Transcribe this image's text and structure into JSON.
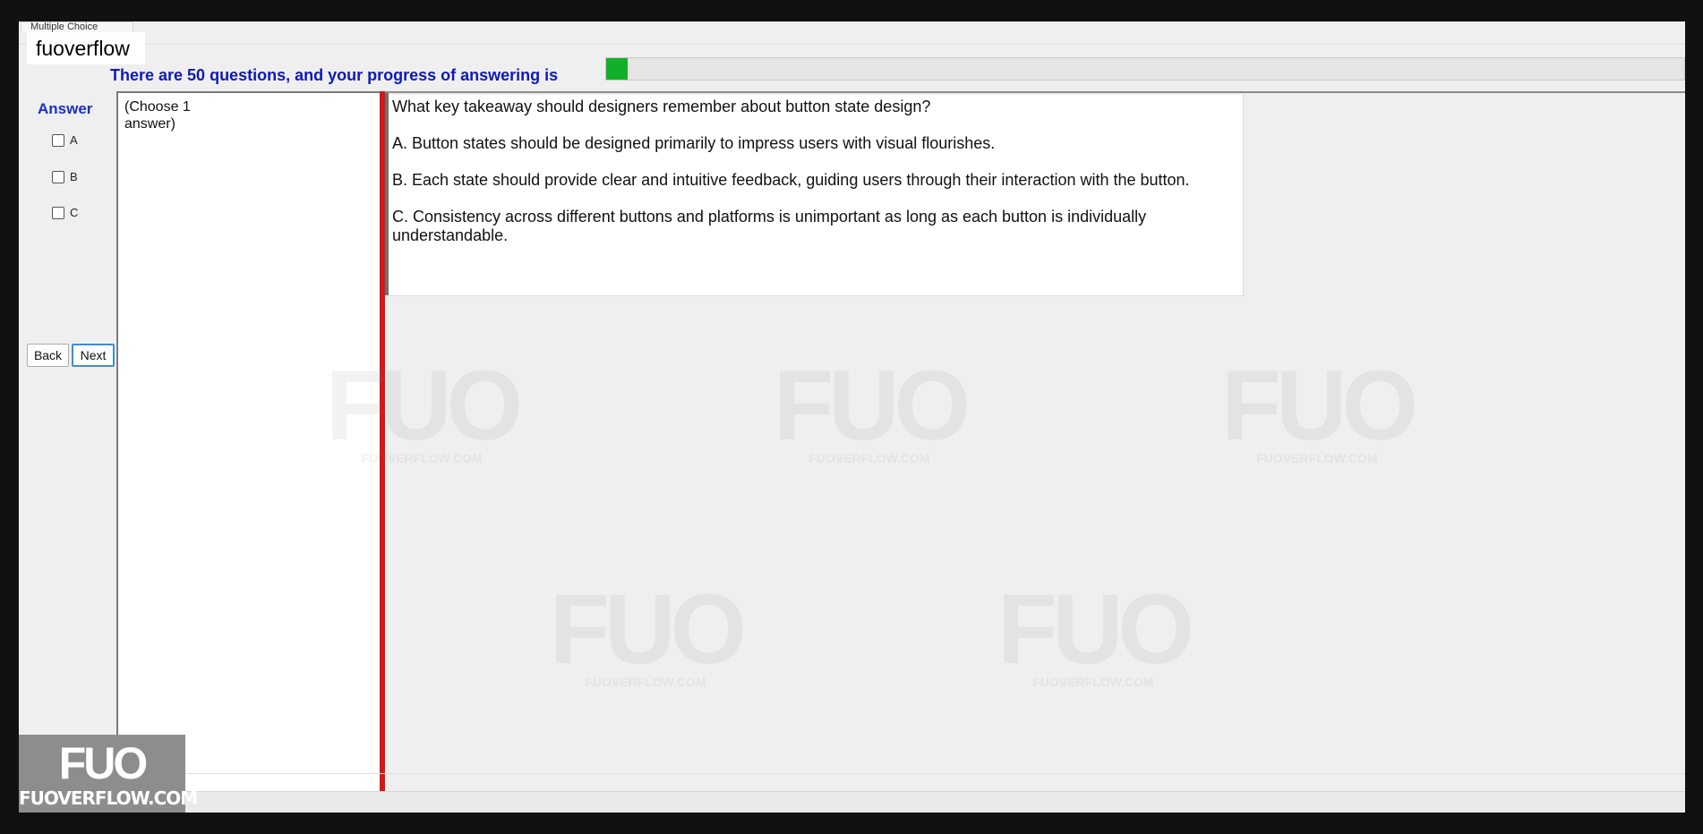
{
  "window": {
    "title": "Multiple Choice",
    "site_label": "fuoverflow"
  },
  "progress": {
    "label": "There are 50 questions, and your progress of answering is",
    "fraction": 0.02,
    "color": "#12b028"
  },
  "answer": {
    "heading": "Answer",
    "options": [
      "A",
      "B",
      "C"
    ],
    "instruction": "(Choose 1\nanswer)"
  },
  "nav": {
    "back_label": "Back",
    "next_label": "Next"
  },
  "question": {
    "text": "What key takeaway should designers remember about button state design?",
    "choices": [
      "A.  Button states should be designed primarily to impress users with visual flourishes.",
      "B.  Each state should provide clear and intuitive feedback, guiding users through their interaction with the button.",
      "C.  Consistency across different buttons and platforms is unimportant as long as each button is individually understandable."
    ]
  },
  "watermark": {
    "mark": "FUO",
    "site": "FUOVERFLOW.COM"
  },
  "logo": {
    "mark": "FUO",
    "site": "FUOVERFLOW.COM"
  },
  "colors": {
    "splitter": "#d91616",
    "answer_heading": "#1a2fc5",
    "progress_text": "#0f1ab5"
  }
}
